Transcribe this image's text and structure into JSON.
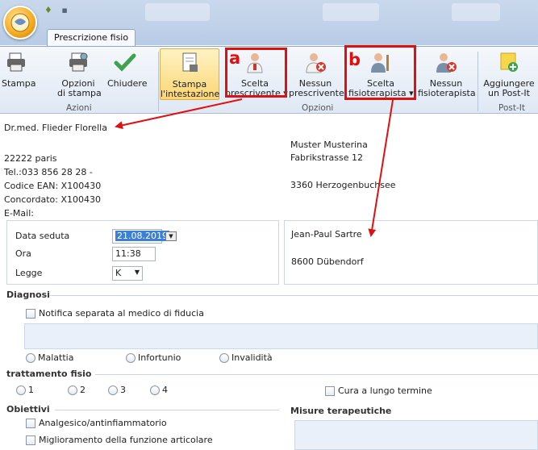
{
  "tab_label": "Prescrizione fisio",
  "ribbon": {
    "buttons": {
      "stampa": "Stampa",
      "opzioni_line1": "Opzioni",
      "opzioni_line2": "di stampa",
      "chiudere": "Chiudere",
      "stampa_int_line1": "Stampa",
      "stampa_int_line2": "l'intestazione",
      "scelta_presc_line1": "Scelta",
      "scelta_presc_line2": "prescrivente ▾",
      "nessun_presc_line1": "Nessun",
      "nessun_presc_line2": "prescrivente",
      "scelta_fisio_line1": "Scelta",
      "scelta_fisio_line2": "fisioterapista ▾",
      "nessun_fisio_line1": "Nessun",
      "nessun_fisio_line2": "fisioterapista",
      "postit_line1": "Aggiungere",
      "postit_line2": "un Post-It"
    },
    "groups": {
      "azioni": "Azioni",
      "opzioni": "Opzioni",
      "postit": "Post-It"
    }
  },
  "annotations": {
    "a": "a",
    "b": "b"
  },
  "prescriber": {
    "name": "Dr.med. Flieder Florella",
    "city": "22222 paris",
    "tel": "Tel.:033 856 28 28 -",
    "ean": "Codice EAN: X100430",
    "concordato": "Concordato: X100430",
    "email": "E-Mail:"
  },
  "patient": {
    "name": "Muster Musterina",
    "street": "Fabrikstrasse 12",
    "city": "3360 Herzogenbuchsee"
  },
  "session": {
    "date_label": "Data seduta",
    "date_value": "21.08.2019",
    "time_label": "Ora",
    "time_value": "11:38",
    "law_label": "Legge",
    "law_value": "K"
  },
  "therapist": {
    "name": "Jean-Paul Sartre",
    "city": "8600 Dübendorf"
  },
  "diagnosi": {
    "title": "Diagnosi",
    "checkbox_label": "Notifica separata al medico di fiducia",
    "radios": [
      "Malattia",
      "Infortunio",
      "Invalidità"
    ]
  },
  "trattamento": {
    "title": "trattamento fisio",
    "radios": [
      "1",
      "2",
      "3",
      "4"
    ],
    "long_term": "Cura a lungo termine"
  },
  "obiettivi": {
    "title": "Obiettivi",
    "items": [
      "Analgesico/antinfiammatorio",
      "Miglioramento della funzione articolare"
    ]
  },
  "misure": {
    "title": "Misure terapeutiche"
  },
  "colors": {
    "annotation": "#e01010",
    "accent": "#3b7fd6"
  }
}
